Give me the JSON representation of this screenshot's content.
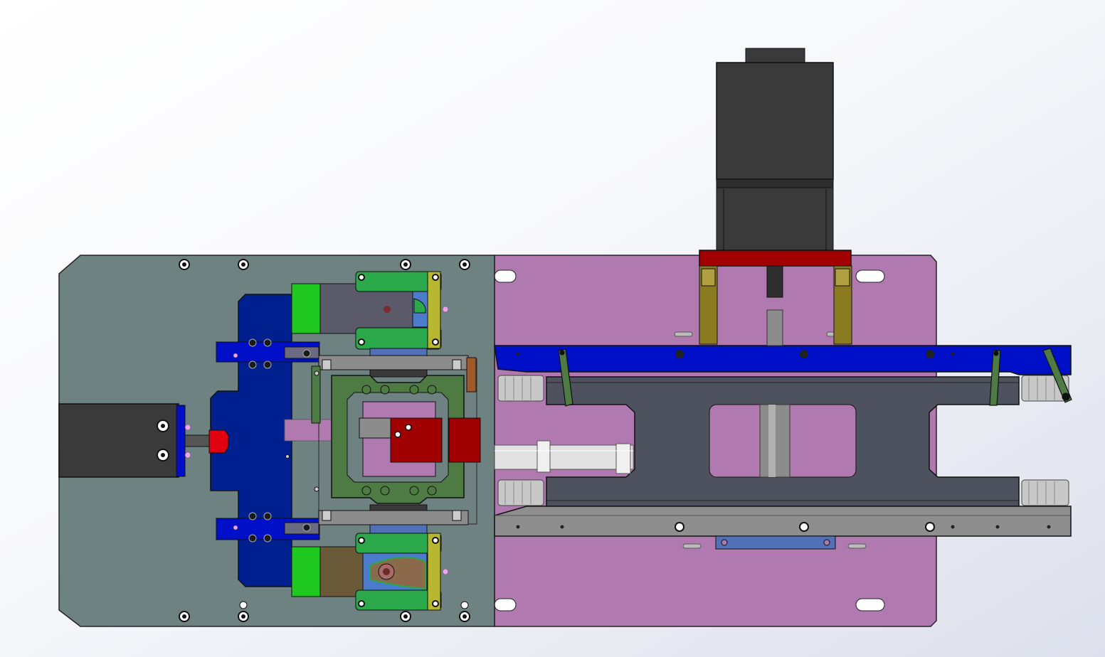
{
  "viewport": {
    "label": "",
    "background_colors": [
      "#ffffff",
      "#dde0ec"
    ]
  },
  "colors": {
    "left_plate": "#6e8282",
    "right_plate": "#b07ab0",
    "blue_dark": "#002090",
    "blue_bright": "#0010c8",
    "green": "#1ec81e",
    "green_frame": "#2aa84a",
    "olive_frame": "#4e7a44",
    "red": "#a00000",
    "motor": "#3a3a3a",
    "slate": "#4e525e",
    "gray_bar": "#8e8e8e",
    "tan": "#8a7a22",
    "yellow": "#b8b830"
  },
  "components": {
    "motor": "stepper-motor",
    "motor_mount": "red-motor-bracket",
    "left_plate": "gray-base-plate",
    "right_plate": "purple-base-plate",
    "belt_beam": "blue-rail",
    "lower_rail": "gray-rail",
    "carriage": "slate-carriage",
    "gripper_frame": "green-gripper-frame",
    "actuator_block": "red-actuator-block"
  }
}
